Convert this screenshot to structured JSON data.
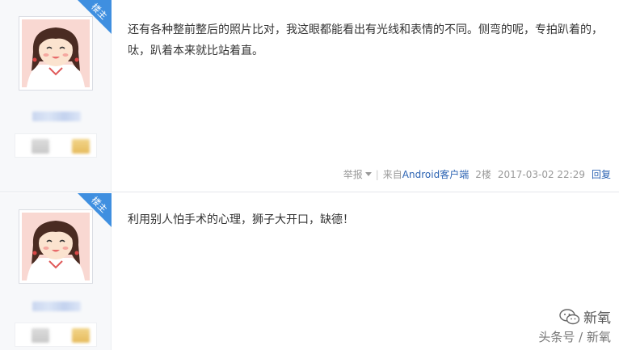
{
  "posts": [
    {
      "badge": "楼主",
      "content": "还有各种整前整后的照片比对，我这眼都能看出有光线和表情的不同。侧弯的呢，专拍趴着的，呔，趴着本来就比站着直。",
      "meta": {
        "report": "举报",
        "source_prefix": "来自",
        "client": "Android客户端",
        "floor": "2楼",
        "time": "2017-03-02 22:29",
        "reply": "回复"
      }
    },
    {
      "badge": "楼主",
      "content": "利用别人怕手术的心理，狮子大开口，缺德！"
    }
  ],
  "watermark": {
    "brand": "新氧",
    "line2": "头条号 / 新氧"
  },
  "colors": {
    "accent": "#3f8fe0",
    "link": "#2d64b3",
    "meta_text": "#999999"
  },
  "icons": {
    "caret": "chevron-down-icon",
    "avatar": "cartoon-girl-avatar",
    "watermark": "wechat-logo-icon"
  }
}
